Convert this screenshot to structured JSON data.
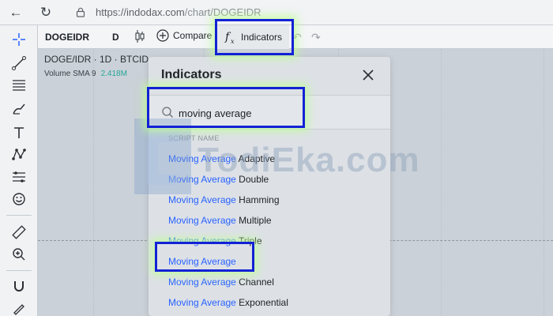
{
  "browser": {
    "url_host": "https://indodax.com",
    "url_path": "/chart/DOGEIDR"
  },
  "chart_toolbar": {
    "symbol": "DOGEIDR",
    "interval": "D",
    "compare_label": "Compare",
    "indicators_label": "Indicators"
  },
  "chart": {
    "series_title": "DOGE/IDR · 1D · BTCID",
    "volume_label": "Volume SMA 9",
    "volume_value": "2.418M"
  },
  "dialog": {
    "title": "Indicators",
    "search_value": "moving average",
    "section_header": "SCRIPT NAME",
    "results": [
      {
        "match": "Moving Average",
        "suffix": " Adaptive"
      },
      {
        "match": "Moving Average",
        "suffix": " Double"
      },
      {
        "match": "Moving Average",
        "suffix": " Hamming"
      },
      {
        "match": "Moving Average",
        "suffix": " Multiple"
      },
      {
        "match": "Moving Average",
        "suffix": " Triple"
      },
      {
        "match": "Moving Average",
        "suffix": ""
      },
      {
        "match": "Moving Average",
        "suffix": " Channel"
      },
      {
        "match": "Moving Average",
        "suffix": " Exponential"
      }
    ]
  },
  "watermark": "TodiEka.com",
  "colors": {
    "highlight_border": "#1222d6",
    "match_text": "#2962ff",
    "volume_value": "#26a69a"
  }
}
